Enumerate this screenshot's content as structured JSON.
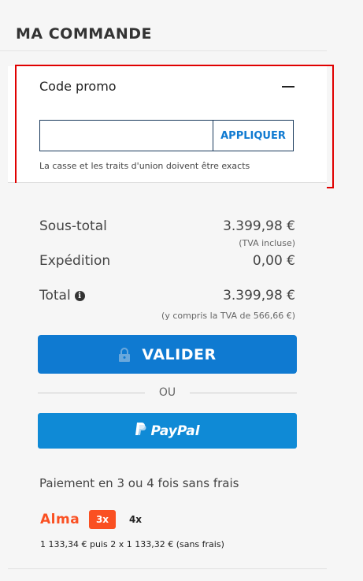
{
  "header": {
    "title": "MA COMMANDE"
  },
  "promo": {
    "title": "Code promo",
    "input_value": "",
    "input_placeholder": "",
    "apply_label": "APPLIQUER",
    "hint": "La casse et les traits d'union doivent être exacts"
  },
  "summary": {
    "subtotal_label": "Sous-total",
    "subtotal_value": "3.399,98 €",
    "subtotal_note": "(TVA incluse)",
    "shipping_label": "Expédition",
    "shipping_value": "0,00 €",
    "total_label": "Total",
    "total_value": "3.399,98 €",
    "total_note": "(y compris la TVA de 566,66 €)"
  },
  "actions": {
    "validate_label": "VALIDER",
    "or_label": "OU",
    "paypal_label": "PayPal"
  },
  "installments": {
    "title": "Paiement en 3 ou 4 fois sans frais",
    "brand": "Alma",
    "option_3x": "3x",
    "option_4x": "4x",
    "detail": "1 133,34 € puis 2 x 1 133,32 € (sans frais)"
  },
  "colors": {
    "primary": "#0f7ad1",
    "paypal": "#0f8ad6",
    "alma": "#fa5022",
    "highlight": "#e00000"
  }
}
